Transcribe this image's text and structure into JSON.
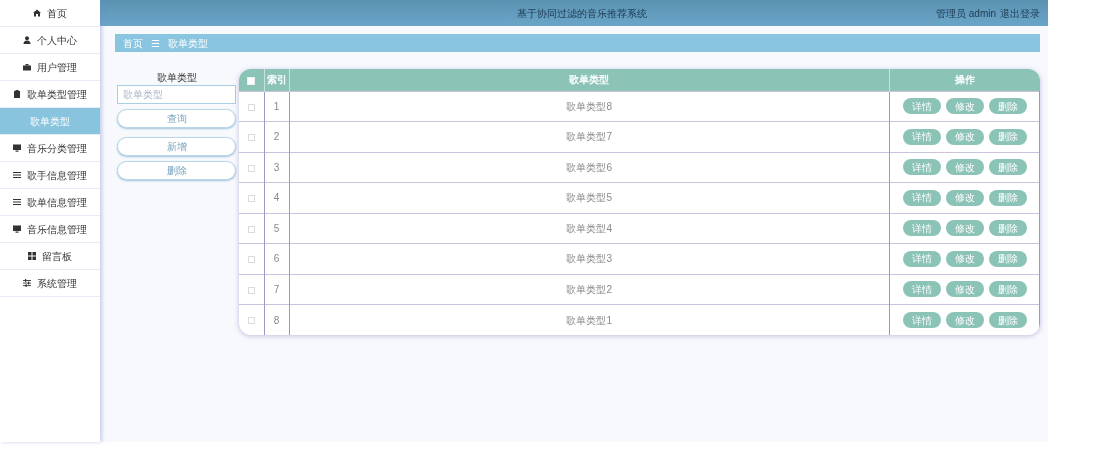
{
  "header": {
    "title": "基于协同过滤的音乐推荐系统",
    "user": "管理员 admin",
    "logout": "退出登录"
  },
  "sidebar": {
    "items": [
      {
        "label": "首页",
        "kind": "home",
        "selected": false
      },
      {
        "label": "个人中心",
        "kind": "user",
        "selected": false
      },
      {
        "label": "用户管理",
        "kind": "briefcase",
        "selected": false
      },
      {
        "label": "歌单类型管理",
        "kind": "clipboard",
        "selected": false
      },
      {
        "label": "歌单类型",
        "kind": "sub",
        "selected": true
      },
      {
        "label": "音乐分类管理",
        "kind": "monitor",
        "selected": false
      },
      {
        "label": "歌手信息管理",
        "kind": "list",
        "selected": false
      },
      {
        "label": "歌单信息管理",
        "kind": "list",
        "selected": false
      },
      {
        "label": "音乐信息管理",
        "kind": "monitor",
        "selected": false
      },
      {
        "label": "留言板",
        "kind": "grid",
        "selected": false
      },
      {
        "label": "系统管理",
        "kind": "sliders",
        "selected": false
      }
    ]
  },
  "breadcrumb": {
    "home": "首页",
    "separator": "☰",
    "current": "歌单类型"
  },
  "search": {
    "label": "歌单类型",
    "placeholder": "歌单类型",
    "buttons": [
      "查询",
      "新增",
      "删除"
    ]
  },
  "table": {
    "select_all_checked": false,
    "columns": [
      "索引",
      "歌单类型",
      "操作"
    ],
    "rows": [
      {
        "index": "1",
        "type": "歌单类型8",
        "checked": false,
        "actions": [
          "详情",
          "修改",
          "删除"
        ]
      },
      {
        "index": "2",
        "type": "歌单类型7",
        "checked": false,
        "actions": [
          "详情",
          "修改",
          "删除"
        ]
      },
      {
        "index": "3",
        "type": "歌单类型6",
        "checked": false,
        "actions": [
          "详情",
          "修改",
          "删除"
        ]
      },
      {
        "index": "4",
        "type": "歌单类型5",
        "checked": false,
        "actions": [
          "详情",
          "修改",
          "删除"
        ]
      },
      {
        "index": "5",
        "type": "歌单类型4",
        "checked": false,
        "actions": [
          "详情",
          "修改",
          "删除"
        ]
      },
      {
        "index": "6",
        "type": "歌单类型3",
        "checked": false,
        "actions": [
          "详情",
          "修改",
          "删除"
        ]
      },
      {
        "index": "7",
        "type": "歌单类型2",
        "checked": false,
        "actions": [
          "详情",
          "修改",
          "删除"
        ]
      },
      {
        "index": "8",
        "type": "歌单类型1",
        "checked": false,
        "actions": [
          "详情",
          "修改",
          "删除"
        ]
      }
    ]
  }
}
